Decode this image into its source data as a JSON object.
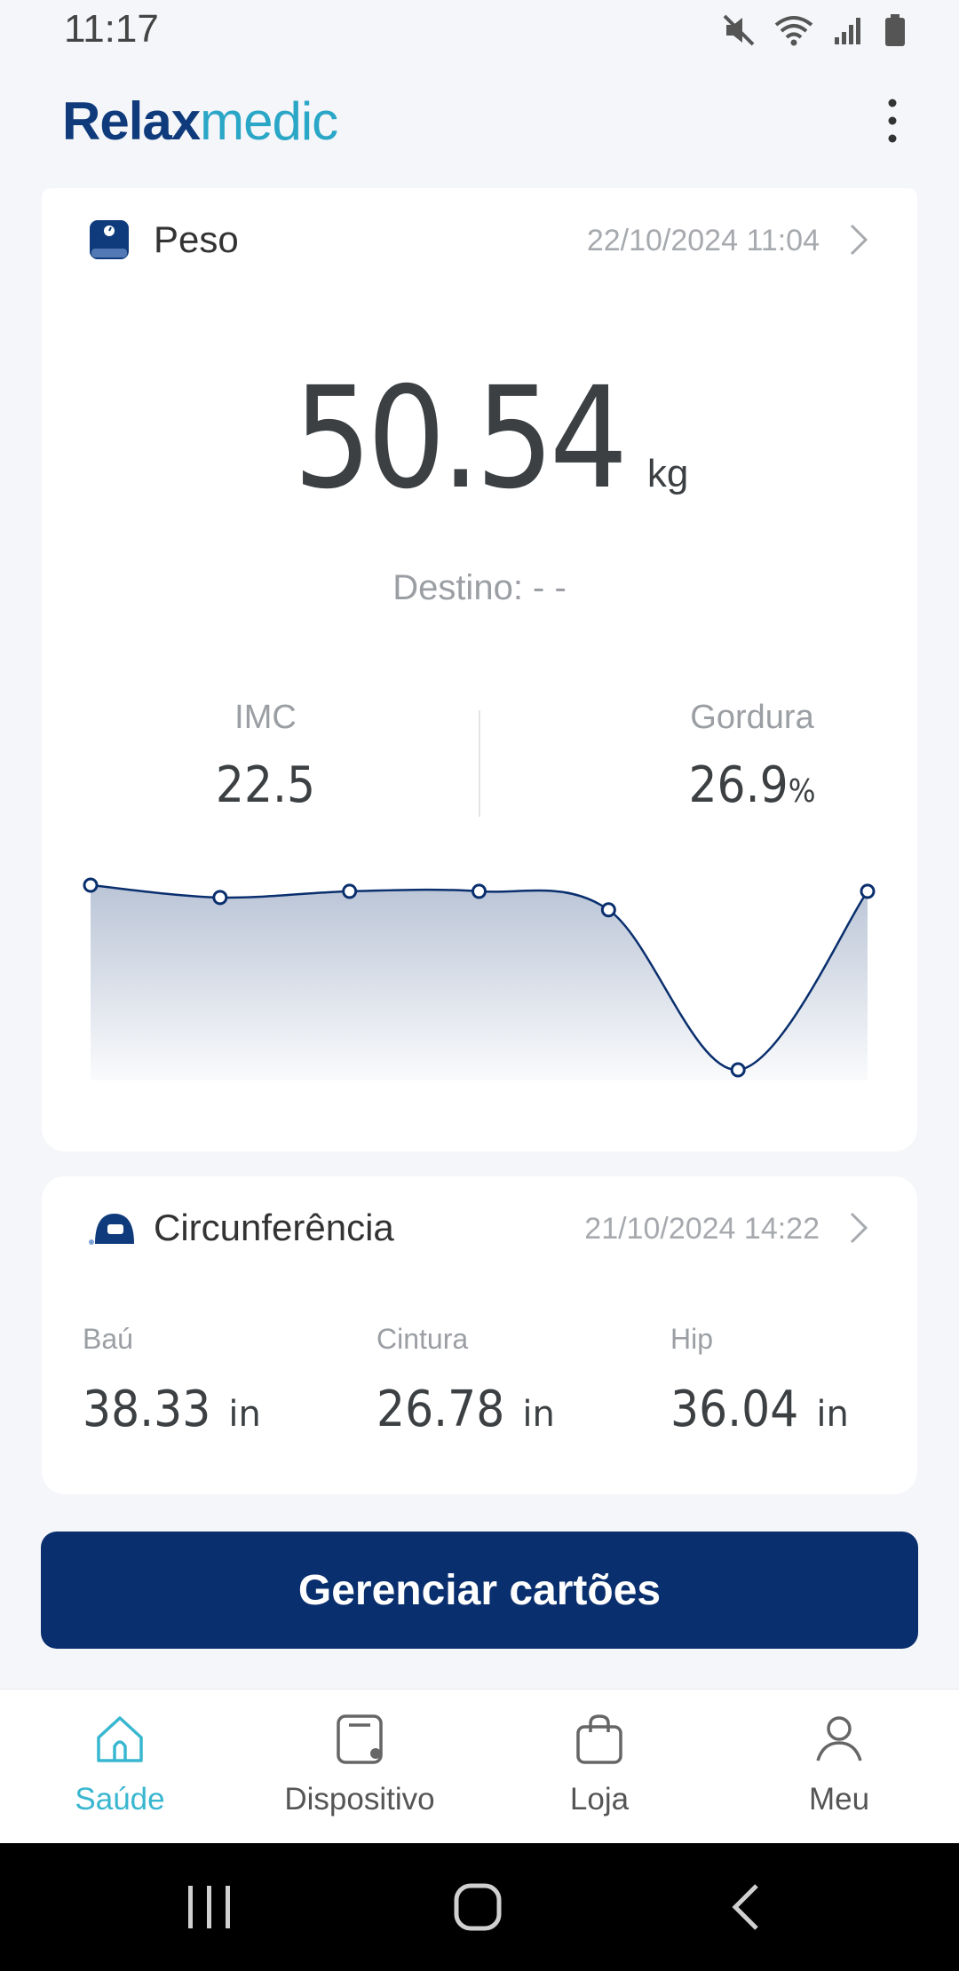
{
  "status_bar": {
    "time": "11:17"
  },
  "app": {
    "logo_part1": "Relax",
    "logo_part2": "medic",
    "menu_icon": "more-vert-icon"
  },
  "weight_card": {
    "title": "Peso",
    "date": "22/10/2024 11:04",
    "value": "50.54",
    "unit": "kg",
    "target": "Destino: - -",
    "imc_label": "IMC",
    "imc_value": "22.5",
    "fat_label": "Gordura",
    "fat_value": "26.9",
    "fat_unit": "%"
  },
  "chart_data": {
    "type": "area",
    "series": [
      {
        "values": [
          50.9,
          50.8,
          50.85,
          50.85,
          50.7,
          49.4,
          50.85
        ]
      }
    ],
    "grid": false,
    "color": "#0a2f6e"
  },
  "circ_card": {
    "title": "Circunferência",
    "date": "21/10/2024 14:22",
    "items": [
      {
        "label": "Baú",
        "value": "38.33",
        "unit": "in"
      },
      {
        "label": "Cintura",
        "value": "26.78",
        "unit": "in"
      },
      {
        "label": "Hip",
        "value": "36.04",
        "unit": "in"
      }
    ]
  },
  "manage_button": "Gerenciar cartões",
  "bottom_nav": [
    {
      "label": "Saúde",
      "icon": "home-icon",
      "active": true
    },
    {
      "label": "Dispositivo",
      "icon": "device-icon",
      "active": false
    },
    {
      "label": "Loja",
      "icon": "shopping-bag-icon",
      "active": false
    },
    {
      "label": "Meu",
      "icon": "person-icon",
      "active": false
    }
  ],
  "colors": {
    "primary": "#0a2f6e",
    "accent": "#39b7d0",
    "logo_dark": "#0f3b7c",
    "logo_light": "#2aa6c6"
  }
}
